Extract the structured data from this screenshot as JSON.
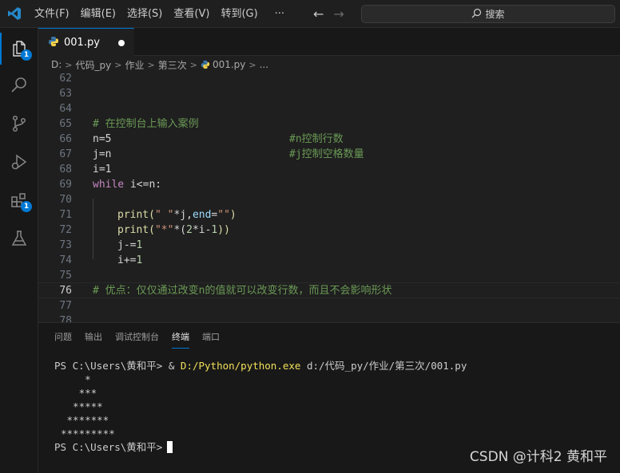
{
  "menu": [
    "文件(F)",
    "编辑(E)",
    "选择(S)",
    "查看(V)",
    "转到(G)",
    "···"
  ],
  "search": {
    "label": "搜索"
  },
  "activity_badges": {
    "explorer": "1",
    "extensions": "1"
  },
  "tab": {
    "label": "001.py"
  },
  "breadcrumb": [
    "D:",
    "代码_py",
    "作业",
    "第三次",
    "001.py",
    "..."
  ],
  "editor": {
    "lines": [
      {
        "n": "62"
      },
      {
        "n": "63"
      },
      {
        "n": "64"
      },
      {
        "n": "65",
        "comment": "# 在控制台上输入案例"
      },
      {
        "n": "66",
        "code": "n=5",
        "trail": "#n控制行数"
      },
      {
        "n": "67",
        "code": "j=n",
        "trail": "#j控制空格数量"
      },
      {
        "n": "68",
        "code": "i=1"
      },
      {
        "n": "69",
        "kw": "while",
        "rest": " i<=n:"
      },
      {
        "n": "70"
      },
      {
        "n": "71",
        "fn": "print",
        "p1": "(",
        "s1": "\" \"",
        "t1": "*j,",
        "v1": "end",
        "t2": "=",
        "s2": "\"\"",
        "p2": ")"
      },
      {
        "n": "72",
        "fn": "print",
        "p1": "(",
        "s1": "\"*\"",
        "t1": "*(",
        "n1": "2",
        "t2": "*i-",
        "n2": "1",
        "p2": "))"
      },
      {
        "n": "73",
        "code": "j-=",
        "num": "1"
      },
      {
        "n": "74",
        "code": "i+=",
        "num": "1"
      },
      {
        "n": "75"
      },
      {
        "n": "76",
        "comment": "# 优点：仅仅通过改变n的值就可以改变行数，而且不会影响形状"
      },
      {
        "n": "77"
      },
      {
        "n": "78"
      }
    ]
  },
  "panel": {
    "tabs": [
      "问题",
      "输出",
      "调试控制台",
      "终端",
      "端口"
    ],
    "active_tab": "终端",
    "prompt": "PS C:\\Users\\黄和平> & ",
    "exe": "D:/Python/python.exe",
    "arg": " d:/代码_py/作业/第三次/001.py",
    "output": [
      "    *",
      "   ***",
      "  *****",
      " *******",
      "*********"
    ],
    "final_prompt": "PS C:\\Users\\黄和平>"
  },
  "watermark": "CSDN @计科2 黄和平",
  "colors": {
    "accent": "#0078d4",
    "comment": "#6a9955",
    "keyword": "#c586c0",
    "function": "#dcdcaa",
    "string": "#ce9178",
    "number": "#b5cea8"
  }
}
